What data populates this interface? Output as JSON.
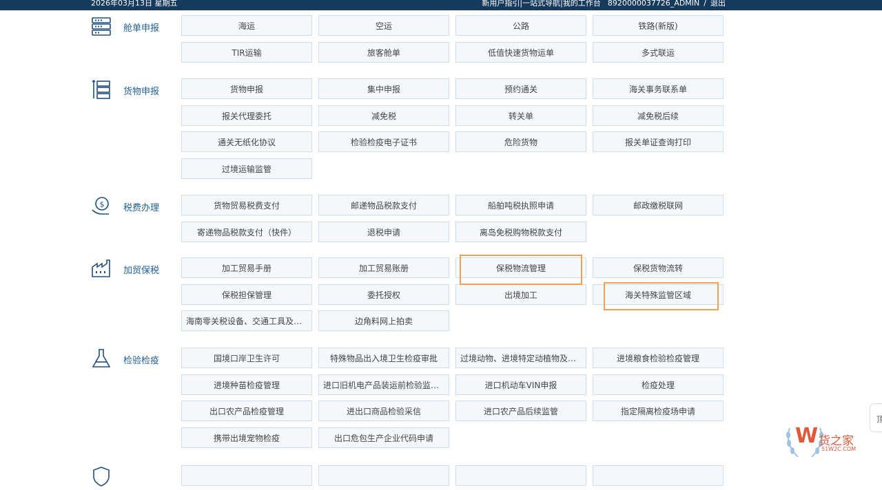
{
  "topbar": {
    "date": "2026年03月13日 星期五",
    "guide": "新用户指引",
    "nav": "一站式导航",
    "workspace": "我的工作台",
    "user": "8920000037726_ADMIN",
    "logout": "退出"
  },
  "sections": [
    {
      "title": "舱单申报",
      "icon": "server-stack-icon",
      "items": [
        "海运",
        "空运",
        "公路",
        "铁路(新版)",
        "TIR运输",
        "旅客舱单",
        "低值快速货物运单",
        "多式联运"
      ]
    },
    {
      "title": "货物申报",
      "icon": "document-stack-icon",
      "items": [
        "货物申报",
        "集中申报",
        "预约通关",
        "海关事务联系单",
        "报关代理委托",
        "减免税",
        "转关单",
        "减免税后续",
        "通关无纸化协议",
        "检验检疫电子证书",
        "危险货物",
        "报关单证查询打印",
        "过境运输监管"
      ]
    },
    {
      "title": "税费办理",
      "icon": "dollar-coin-icon",
      "items": [
        "货物贸易税费支付",
        "邮递物品税款支付",
        "船舶吨税执照申请",
        "邮政缴税联网",
        "寄递物品税款支付（快件）",
        "退税申请",
        "离岛免税购物税款支付"
      ]
    },
    {
      "title": "加贸保税",
      "icon": "factory-icon",
      "items": [
        "加工贸易手册",
        "加工贸易账册",
        "保税物流管理",
        "保税货物流转",
        "保税担保管理",
        "委托授权",
        "出境加工",
        "海关特殊监管区域",
        "海南零关税设备、交通工具及游艇",
        "边角料网上拍卖"
      ]
    },
    {
      "title": "检验检疫",
      "icon": "flask-icon",
      "items": [
        "国境口岸卫生许可",
        "特殊物品出入境卫生检疫审批",
        "过境动物、进境特定动植物及其...",
        "进境粮食检验检疫管理",
        "进境种苗检疫管理",
        "进口旧机电产品装运前检验监督...",
        "进口机动车VIN申报",
        "检疫处理",
        "出口农产品检疫管理",
        "进出口商品检验采信",
        "进口农产品后续监管",
        "指定隔离检疫场申请",
        "携带出境宠物检疫",
        "出口危包生产企业代码申请"
      ]
    },
    {
      "title": "",
      "icon": "shield-icon",
      "items": [
        "",
        "",
        "",
        ""
      ]
    }
  ],
  "watermark": {
    "brand": "货之家",
    "domain": "51W2C.COM",
    "letter": "W"
  },
  "sidetab": {
    "label": "顶"
  },
  "colors": {
    "topbar": "#163a5e",
    "accent": "#1e5f94",
    "highlight": "#f0a050",
    "button_bg": "#f4f8fb"
  }
}
